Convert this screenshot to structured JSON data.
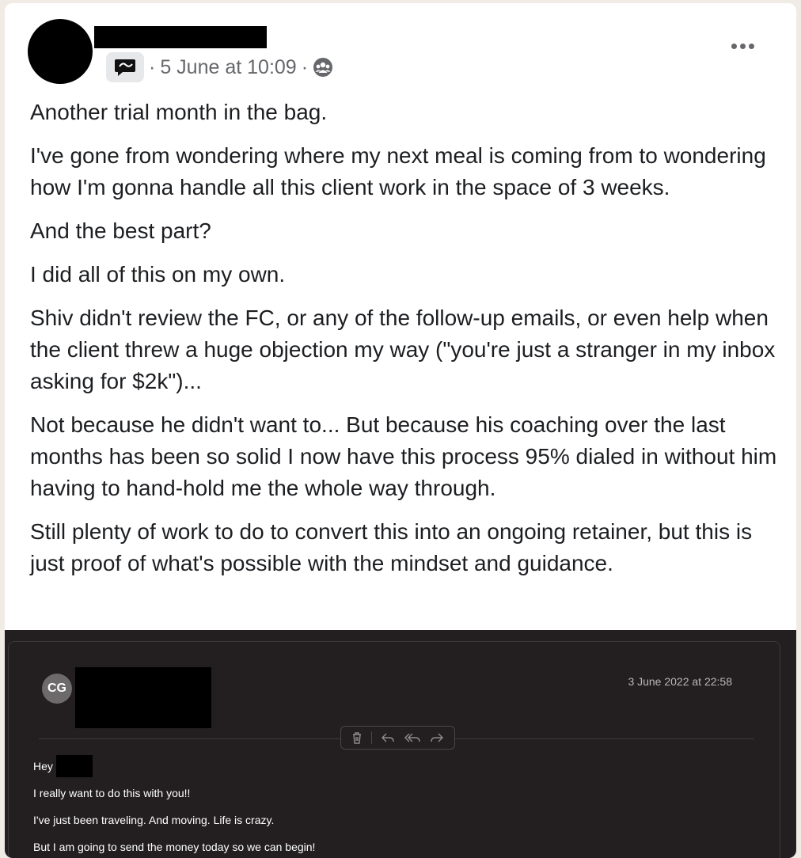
{
  "post": {
    "timestamp": "5 June at 10:09",
    "separator": "·",
    "paragraphs": [
      "Another trial month in the bag.",
      "I've gone from wondering where my next meal is coming from to wondering how I'm gonna handle all this client work in the space of 3 weeks.",
      "And the best part?",
      "I did all of this on my own.",
      "Shiv didn't review the FC, or any of the follow-up emails, or even help when the client threw a huge objection my way (\"you're just a stranger in my inbox asking for $2k\")...",
      "Not because he didn't want to... But because his coaching over the last months has been so solid I now have this process 95% dialed in without him having to hand-hold me the whole way through.",
      "Still plenty of work to do to convert this into an ongoing retainer, but this is just proof of what's possible with the mindset and guidance."
    ],
    "icons": {
      "type": "message-bubble-icon",
      "audience": "group-audience-icon",
      "menu": "more-options-icon"
    }
  },
  "email": {
    "sender_initials": "CG",
    "date": "3 June 2022 at 22:58",
    "toolbar": [
      "trash-icon",
      "reply-icon",
      "reply-all-icon",
      "forward-icon"
    ],
    "greeting": "Hey",
    "lines": [
      "I really want to do this with you!!",
      "I've just been traveling. And moving. Life is crazy.",
      "But I am going to send the money today so we can begin!"
    ]
  }
}
